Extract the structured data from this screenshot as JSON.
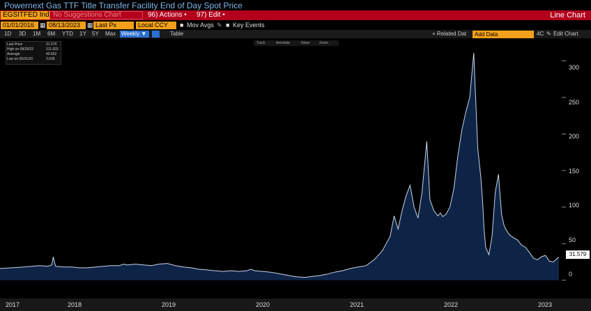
{
  "window": {
    "title": "Powernext Gas TTF Title Transfer Facility End of Day Spot Price"
  },
  "toolbar": {
    "ticker": "EGSITFED Index",
    "security_field": "No Suggestions Chart",
    "actions_label": "96) Actions •",
    "edit_label": "97) Edit •",
    "chart_type": "Line Chart"
  },
  "controls": {
    "start_date": "01/01/2016",
    "end_date": "08/13/2023",
    "field": "Last Px",
    "currency": "Local CCY",
    "mov_avgs": "Mov Avgs",
    "key_events": "Key Events"
  },
  "range": {
    "buttons": [
      "1D",
      "3D",
      "1M",
      "6M",
      "YTD",
      "1Y",
      "5Y",
      "Max"
    ],
    "frequency": "Weekly",
    "table": "Table",
    "related_data": "+ Related Dat",
    "add_data_placeholder": "Add Data",
    "edit_chart": "Edit Chart"
  },
  "chart_tools": [
    "Track",
    "Annotate",
    "News",
    "Zoom"
  ],
  "legend": {
    "rows": [
      {
        "label": "Last Price",
        "value": "31.579"
      },
      {
        "label": "High on 08/26/22",
        "value": "311.933"
      },
      {
        "label": "Average",
        "value": "40.662"
      },
      {
        "label": "Low on 05/31/20",
        "value": "3.539"
      }
    ]
  },
  "last_price_tag": "31.579",
  "colors": {
    "accent": "#f2a01a",
    "bar_red": "#b3001c",
    "area_fill": "#0e2447",
    "line": "#c8d4e6",
    "title_blue": "#7fb6e8",
    "selected_blue": "#2a6fd3"
  },
  "chart_data": {
    "type": "area",
    "title": "Powernext Gas TTF Title Transfer Facility End of Day Spot Price",
    "xlabel": "",
    "ylabel": "",
    "x_ticks": [
      "2017",
      "2018",
      "2019",
      "2020",
      "2021",
      "2022",
      "2023"
    ],
    "y_ticks": [
      "0",
      "50",
      "100",
      "150",
      "200",
      "250",
      "300"
    ],
    "ylim": [
      -25,
      330
    ],
    "xlim": [
      2016.6,
      2023.62
    ],
    "grid": false,
    "legend": "top-left",
    "series": [
      {
        "name": "Last Price",
        "x": [
          2016.6,
          2016.75,
          2016.9,
          2017.0,
          2017.1,
          2017.2,
          2017.25,
          2017.27,
          2017.29,
          2017.3,
          2017.4,
          2017.5,
          2017.6,
          2017.7,
          2017.8,
          2017.9,
          2018.0,
          2018.1,
          2018.15,
          2018.2,
          2018.3,
          2018.4,
          2018.5,
          2018.6,
          2018.7,
          2018.8,
          2018.9,
          2019.0,
          2019.1,
          2019.2,
          2019.3,
          2019.4,
          2019.5,
          2019.6,
          2019.7,
          2019.75,
          2019.8,
          2019.9,
          2020.0,
          2020.1,
          2020.2,
          2020.3,
          2020.4,
          2020.45,
          2020.5,
          2020.6,
          2020.7,
          2020.8,
          2020.9,
          2021.0,
          2021.1,
          2021.2,
          2021.3,
          2021.4,
          2021.5,
          2021.55,
          2021.6,
          2021.65,
          2021.7,
          2021.75,
          2021.8,
          2021.85,
          2021.9,
          2021.93,
          2021.96,
          2022.0,
          2022.05,
          2022.1,
          2022.13,
          2022.16,
          2022.2,
          2022.25,
          2022.3,
          2022.35,
          2022.4,
          2022.45,
          2022.5,
          2022.55,
          2022.6,
          2022.62,
          2022.64,
          2022.66,
          2022.68,
          2022.7,
          2022.74,
          2022.78,
          2022.82,
          2022.86,
          2022.9,
          2022.93,
          2022.95,
          2022.98,
          2023.0,
          2023.05,
          2023.1,
          2023.15,
          2023.2,
          2023.25,
          2023.3,
          2023.35,
          2023.4,
          2023.45,
          2023.5,
          2023.55,
          2023.6,
          2023.62
        ],
        "values": [
          16,
          17,
          18,
          19,
          20,
          19,
          21,
          32,
          22,
          19,
          18,
          18,
          17,
          17,
          18,
          19,
          20,
          20,
          22,
          21,
          22,
          21,
          20,
          22,
          23,
          20,
          18,
          17,
          15,
          14,
          13,
          12,
          13,
          12,
          13,
          15,
          13,
          12,
          11,
          9,
          7,
          5,
          4,
          4,
          5,
          6,
          8,
          11,
          13,
          16,
          18,
          20,
          28,
          40,
          60,
          88,
          70,
          95,
          115,
          130,
          100,
          85,
          120,
          155,
          190,
          110,
          95,
          88,
          92,
          87,
          90,
          100,
          125,
          170,
          205,
          230,
          250,
          311,
          180,
          160,
          140,
          110,
          70,
          45,
          35,
          60,
          120,
          145,
          90,
          75,
          70,
          65,
          62,
          58,
          55,
          48,
          45,
          38,
          30,
          28,
          32,
          34,
          26,
          25,
          30,
          31.579
        ]
      }
    ]
  }
}
